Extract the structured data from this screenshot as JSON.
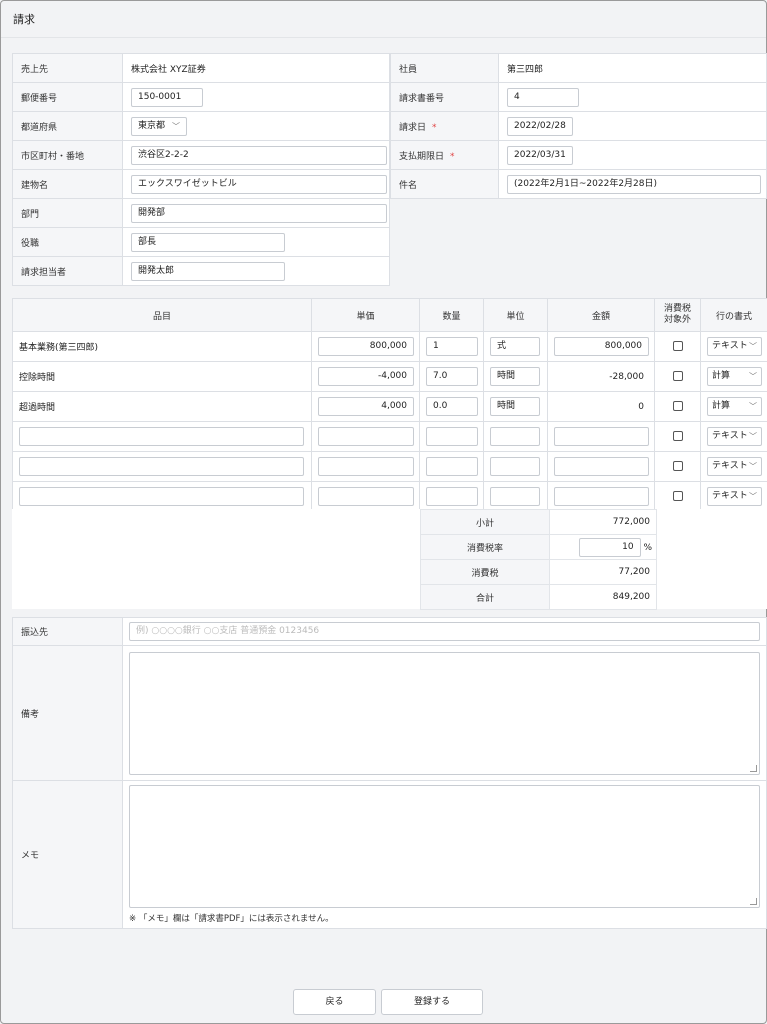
{
  "page": {
    "title": "請求"
  },
  "billing": {
    "customer_label": "売上先",
    "customer_value": "株式会社 XYZ証券",
    "postal_label": "郵便番号",
    "postal_value": "150-0001",
    "prefecture_label": "都道府県",
    "prefecture_value": "東京都",
    "city_label": "市区町村・番地",
    "city_value": "渋谷区2-2-2",
    "building_label": "建物名",
    "building_value": "エックスワイゼットビル",
    "department_label": "部門",
    "department_value": "開発部",
    "position_label": "役職",
    "position_value": "部長",
    "contact_label": "請求担当者",
    "contact_value": "開発太郎"
  },
  "invoice": {
    "employee_label": "社員",
    "employee_value": "第三四郎",
    "number_label": "請求書番号",
    "number_value": "4",
    "date_label": "請求日",
    "date_value": "2022/02/28",
    "due_label": "支払期限日",
    "due_value": "2022/03/31",
    "subject_label": "件名",
    "subject_value": "(2022年2月1日~2022年2月28日)",
    "required_mark": "*"
  },
  "items": {
    "headers": {
      "item": "品目",
      "unit_price": "単価",
      "qty": "数量",
      "unit": "単位",
      "amount": "金額",
      "tax_exempt_1": "消費税",
      "tax_exempt_2": "対象外",
      "row_format": "行の書式"
    },
    "rows": [
      {
        "name": "基本業務(第三四郎)",
        "unit_price": "800,000",
        "qty": "1",
        "unit": "式",
        "amount": "800,000",
        "format": "テキスト"
      },
      {
        "name": "控除時間",
        "unit_price": "-4,000",
        "qty": "7.0",
        "unit": "時間",
        "amount": "-28,000",
        "format": "計算"
      },
      {
        "name": "超過時間",
        "unit_price": "4,000",
        "qty": "0.0",
        "unit": "時間",
        "amount": "0",
        "format": "計算"
      },
      {
        "name": "",
        "unit_price": "",
        "qty": "",
        "unit": "",
        "amount": "",
        "format": "テキスト"
      },
      {
        "name": "",
        "unit_price": "",
        "qty": "",
        "unit": "",
        "amount": "",
        "format": "テキスト"
      },
      {
        "name": "",
        "unit_price": "",
        "qty": "",
        "unit": "",
        "amount": "",
        "format": "テキスト"
      }
    ]
  },
  "totals": {
    "subtotal_label": "小計",
    "subtotal_value": "772,000",
    "tax_rate_label": "消費税率",
    "tax_rate_value": "10",
    "tax_rate_unit": "%",
    "tax_label": "消費税",
    "tax_value": "77,200",
    "total_label": "合計",
    "total_value": "849,200"
  },
  "bottom": {
    "bank_label": "振込先",
    "bank_placeholder": "例) ○○○○銀行 ○○支店 普通預金 0123456",
    "remarks_label": "備考",
    "memo_label": "メモ",
    "memo_note": "※ 「メモ」欄は「請求書PDF」には表示されません。"
  },
  "buttons": {
    "back": "戻る",
    "register": "登録する"
  }
}
